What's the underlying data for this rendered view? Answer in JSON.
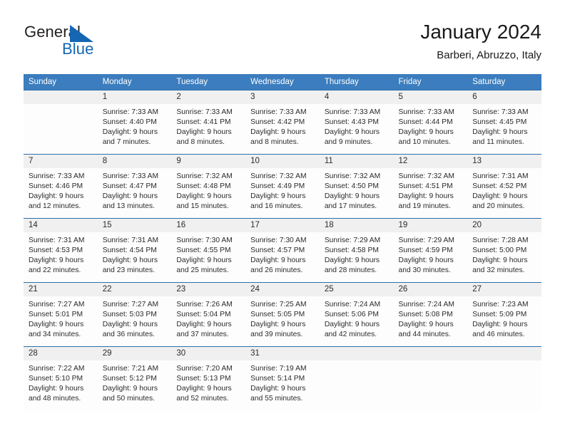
{
  "brand": {
    "name_part1": "General",
    "name_part2": "Blue",
    "triangle_color": "#1567b3"
  },
  "header": {
    "title": "January 2024",
    "subtitle": "Barberi, Abruzzo, Italy"
  },
  "theme": {
    "header_bg": "#3b7dbe",
    "header_text": "#ffffff",
    "row_divider": "#2f6eac",
    "daynum_bg": "#f0f0f0",
    "cell_bg": "#fdfdfd",
    "text": "#2b2b2b"
  },
  "weekday_headers": [
    "Sunday",
    "Monday",
    "Tuesday",
    "Wednesday",
    "Thursday",
    "Friday",
    "Saturday"
  ],
  "labels": {
    "sunrise_prefix": "Sunrise: ",
    "sunset_prefix": "Sunset: ",
    "daylight_prefix": "Daylight: "
  },
  "weeks": [
    [
      {
        "day": "",
        "sunrise": "",
        "sunset": "",
        "daylight_line1": "",
        "daylight_line2": ""
      },
      {
        "day": "1",
        "sunrise": "Sunrise: 7:33 AM",
        "sunset": "Sunset: 4:40 PM",
        "daylight_line1": "Daylight: 9 hours",
        "daylight_line2": "and 7 minutes."
      },
      {
        "day": "2",
        "sunrise": "Sunrise: 7:33 AM",
        "sunset": "Sunset: 4:41 PM",
        "daylight_line1": "Daylight: 9 hours",
        "daylight_line2": "and 8 minutes."
      },
      {
        "day": "3",
        "sunrise": "Sunrise: 7:33 AM",
        "sunset": "Sunset: 4:42 PM",
        "daylight_line1": "Daylight: 9 hours",
        "daylight_line2": "and 8 minutes."
      },
      {
        "day": "4",
        "sunrise": "Sunrise: 7:33 AM",
        "sunset": "Sunset: 4:43 PM",
        "daylight_line1": "Daylight: 9 hours",
        "daylight_line2": "and 9 minutes."
      },
      {
        "day": "5",
        "sunrise": "Sunrise: 7:33 AM",
        "sunset": "Sunset: 4:44 PM",
        "daylight_line1": "Daylight: 9 hours",
        "daylight_line2": "and 10 minutes."
      },
      {
        "day": "6",
        "sunrise": "Sunrise: 7:33 AM",
        "sunset": "Sunset: 4:45 PM",
        "daylight_line1": "Daylight: 9 hours",
        "daylight_line2": "and 11 minutes."
      }
    ],
    [
      {
        "day": "7",
        "sunrise": "Sunrise: 7:33 AM",
        "sunset": "Sunset: 4:46 PM",
        "daylight_line1": "Daylight: 9 hours",
        "daylight_line2": "and 12 minutes."
      },
      {
        "day": "8",
        "sunrise": "Sunrise: 7:33 AM",
        "sunset": "Sunset: 4:47 PM",
        "daylight_line1": "Daylight: 9 hours",
        "daylight_line2": "and 13 minutes."
      },
      {
        "day": "9",
        "sunrise": "Sunrise: 7:32 AM",
        "sunset": "Sunset: 4:48 PM",
        "daylight_line1": "Daylight: 9 hours",
        "daylight_line2": "and 15 minutes."
      },
      {
        "day": "10",
        "sunrise": "Sunrise: 7:32 AM",
        "sunset": "Sunset: 4:49 PM",
        "daylight_line1": "Daylight: 9 hours",
        "daylight_line2": "and 16 minutes."
      },
      {
        "day": "11",
        "sunrise": "Sunrise: 7:32 AM",
        "sunset": "Sunset: 4:50 PM",
        "daylight_line1": "Daylight: 9 hours",
        "daylight_line2": "and 17 minutes."
      },
      {
        "day": "12",
        "sunrise": "Sunrise: 7:32 AM",
        "sunset": "Sunset: 4:51 PM",
        "daylight_line1": "Daylight: 9 hours",
        "daylight_line2": "and 19 minutes."
      },
      {
        "day": "13",
        "sunrise": "Sunrise: 7:31 AM",
        "sunset": "Sunset: 4:52 PM",
        "daylight_line1": "Daylight: 9 hours",
        "daylight_line2": "and 20 minutes."
      }
    ],
    [
      {
        "day": "14",
        "sunrise": "Sunrise: 7:31 AM",
        "sunset": "Sunset: 4:53 PM",
        "daylight_line1": "Daylight: 9 hours",
        "daylight_line2": "and 22 minutes."
      },
      {
        "day": "15",
        "sunrise": "Sunrise: 7:31 AM",
        "sunset": "Sunset: 4:54 PM",
        "daylight_line1": "Daylight: 9 hours",
        "daylight_line2": "and 23 minutes."
      },
      {
        "day": "16",
        "sunrise": "Sunrise: 7:30 AM",
        "sunset": "Sunset: 4:55 PM",
        "daylight_line1": "Daylight: 9 hours",
        "daylight_line2": "and 25 minutes."
      },
      {
        "day": "17",
        "sunrise": "Sunrise: 7:30 AM",
        "sunset": "Sunset: 4:57 PM",
        "daylight_line1": "Daylight: 9 hours",
        "daylight_line2": "and 26 minutes."
      },
      {
        "day": "18",
        "sunrise": "Sunrise: 7:29 AM",
        "sunset": "Sunset: 4:58 PM",
        "daylight_line1": "Daylight: 9 hours",
        "daylight_line2": "and 28 minutes."
      },
      {
        "day": "19",
        "sunrise": "Sunrise: 7:29 AM",
        "sunset": "Sunset: 4:59 PM",
        "daylight_line1": "Daylight: 9 hours",
        "daylight_line2": "and 30 minutes."
      },
      {
        "day": "20",
        "sunrise": "Sunrise: 7:28 AM",
        "sunset": "Sunset: 5:00 PM",
        "daylight_line1": "Daylight: 9 hours",
        "daylight_line2": "and 32 minutes."
      }
    ],
    [
      {
        "day": "21",
        "sunrise": "Sunrise: 7:27 AM",
        "sunset": "Sunset: 5:01 PM",
        "daylight_line1": "Daylight: 9 hours",
        "daylight_line2": "and 34 minutes."
      },
      {
        "day": "22",
        "sunrise": "Sunrise: 7:27 AM",
        "sunset": "Sunset: 5:03 PM",
        "daylight_line1": "Daylight: 9 hours",
        "daylight_line2": "and 36 minutes."
      },
      {
        "day": "23",
        "sunrise": "Sunrise: 7:26 AM",
        "sunset": "Sunset: 5:04 PM",
        "daylight_line1": "Daylight: 9 hours",
        "daylight_line2": "and 37 minutes."
      },
      {
        "day": "24",
        "sunrise": "Sunrise: 7:25 AM",
        "sunset": "Sunset: 5:05 PM",
        "daylight_line1": "Daylight: 9 hours",
        "daylight_line2": "and 39 minutes."
      },
      {
        "day": "25",
        "sunrise": "Sunrise: 7:24 AM",
        "sunset": "Sunset: 5:06 PM",
        "daylight_line1": "Daylight: 9 hours",
        "daylight_line2": "and 42 minutes."
      },
      {
        "day": "26",
        "sunrise": "Sunrise: 7:24 AM",
        "sunset": "Sunset: 5:08 PM",
        "daylight_line1": "Daylight: 9 hours",
        "daylight_line2": "and 44 minutes."
      },
      {
        "day": "27",
        "sunrise": "Sunrise: 7:23 AM",
        "sunset": "Sunset: 5:09 PM",
        "daylight_line1": "Daylight: 9 hours",
        "daylight_line2": "and 46 minutes."
      }
    ],
    [
      {
        "day": "28",
        "sunrise": "Sunrise: 7:22 AM",
        "sunset": "Sunset: 5:10 PM",
        "daylight_line1": "Daylight: 9 hours",
        "daylight_line2": "and 48 minutes."
      },
      {
        "day": "29",
        "sunrise": "Sunrise: 7:21 AM",
        "sunset": "Sunset: 5:12 PM",
        "daylight_line1": "Daylight: 9 hours",
        "daylight_line2": "and 50 minutes."
      },
      {
        "day": "30",
        "sunrise": "Sunrise: 7:20 AM",
        "sunset": "Sunset: 5:13 PM",
        "daylight_line1": "Daylight: 9 hours",
        "daylight_line2": "and 52 minutes."
      },
      {
        "day": "31",
        "sunrise": "Sunrise: 7:19 AM",
        "sunset": "Sunset: 5:14 PM",
        "daylight_line1": "Daylight: 9 hours",
        "daylight_line2": "and 55 minutes."
      },
      {
        "day": "",
        "sunrise": "",
        "sunset": "",
        "daylight_line1": "",
        "daylight_line2": ""
      },
      {
        "day": "",
        "sunrise": "",
        "sunset": "",
        "daylight_line1": "",
        "daylight_line2": ""
      },
      {
        "day": "",
        "sunrise": "",
        "sunset": "",
        "daylight_line1": "",
        "daylight_line2": ""
      }
    ]
  ]
}
